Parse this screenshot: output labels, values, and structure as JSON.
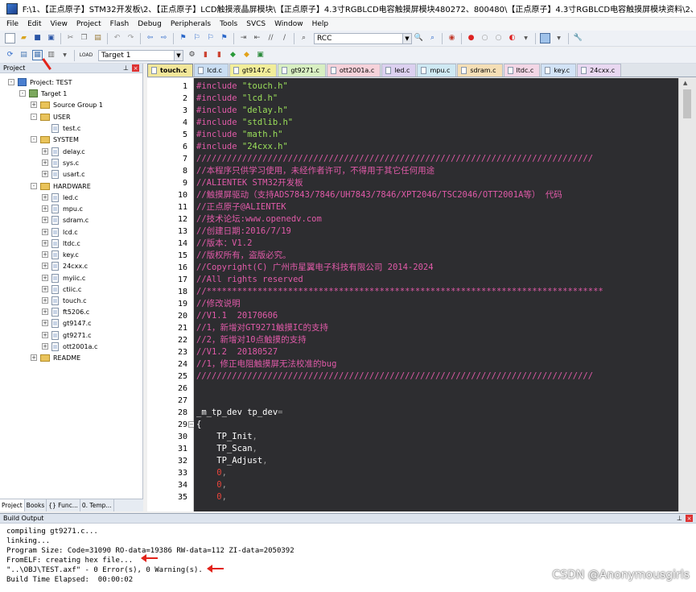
{
  "window": {
    "title": "F:\\1、【正点原子】STM32开发板\\2、【正点原子】LCD触摸液晶屏模块\\【正点原子】4.3寸RGBLCD电容触摸屏模块480272、800480\\【正点原子】4.3寸RGBLCD电容触摸屏模块资料\\2、程..."
  },
  "menu": [
    "File",
    "Edit",
    "View",
    "Project",
    "Flash",
    "Debug",
    "Peripherals",
    "Tools",
    "SVCS",
    "Window",
    "Help"
  ],
  "toolbar": {
    "combo_rcc": "RCC",
    "target_select": "Target 1",
    "load_label": "LOAD"
  },
  "project": {
    "header": "Project",
    "tree": [
      {
        "label": "Project: TEST",
        "depth": 0,
        "type": "project",
        "exp": "-"
      },
      {
        "label": "Target 1",
        "depth": 1,
        "type": "target",
        "exp": "-"
      },
      {
        "label": "Source Group 1",
        "depth": 2,
        "type": "folder",
        "exp": "+"
      },
      {
        "label": "USER",
        "depth": 2,
        "type": "folder",
        "exp": "-"
      },
      {
        "label": "test.c",
        "depth": 3,
        "type": "file",
        "exp": ""
      },
      {
        "label": "SYSTEM",
        "depth": 2,
        "type": "folder",
        "exp": "-"
      },
      {
        "label": "delay.c",
        "depth": 3,
        "type": "file",
        "exp": "+"
      },
      {
        "label": "sys.c",
        "depth": 3,
        "type": "file",
        "exp": "+"
      },
      {
        "label": "usart.c",
        "depth": 3,
        "type": "file",
        "exp": "+"
      },
      {
        "label": "HARDWARE",
        "depth": 2,
        "type": "folder",
        "exp": "-"
      },
      {
        "label": "led.c",
        "depth": 3,
        "type": "file",
        "exp": "+"
      },
      {
        "label": "mpu.c",
        "depth": 3,
        "type": "file",
        "exp": "+"
      },
      {
        "label": "sdram.c",
        "depth": 3,
        "type": "file",
        "exp": "+"
      },
      {
        "label": "lcd.c",
        "depth": 3,
        "type": "file",
        "exp": "+"
      },
      {
        "label": "ltdc.c",
        "depth": 3,
        "type": "file",
        "exp": "+"
      },
      {
        "label": "key.c",
        "depth": 3,
        "type": "file",
        "exp": "+"
      },
      {
        "label": "24cxx.c",
        "depth": 3,
        "type": "file",
        "exp": "+"
      },
      {
        "label": "myiic.c",
        "depth": 3,
        "type": "file",
        "exp": "+"
      },
      {
        "label": "ctiic.c",
        "depth": 3,
        "type": "file",
        "exp": "+"
      },
      {
        "label": "touch.c",
        "depth": 3,
        "type": "file",
        "exp": "+"
      },
      {
        "label": "ft5206.c",
        "depth": 3,
        "type": "file",
        "exp": "+"
      },
      {
        "label": "gt9147.c",
        "depth": 3,
        "type": "file",
        "exp": "+"
      },
      {
        "label": "gt9271.c",
        "depth": 3,
        "type": "file",
        "exp": "+"
      },
      {
        "label": "ott2001a.c",
        "depth": 3,
        "type": "file",
        "exp": "+"
      },
      {
        "label": "README",
        "depth": 2,
        "type": "folder",
        "exp": "+"
      }
    ],
    "tabs": [
      "Project",
      "Books",
      "{} Func...",
      "0. Temp..."
    ]
  },
  "editor": {
    "tabs": [
      {
        "label": "touch.c",
        "color": "#f2e79a",
        "active": true
      },
      {
        "label": "lcd.c",
        "color": "#c9ddf2",
        "active": false
      },
      {
        "label": "gt9147.c",
        "color": "#f2ee9a",
        "active": false
      },
      {
        "label": "gt9271.c",
        "color": "#d8efc2",
        "active": false
      },
      {
        "label": "ott2001a.c",
        "color": "#f6d2da",
        "active": false
      },
      {
        "label": "led.c",
        "color": "#dcd0f0",
        "active": false
      },
      {
        "label": "mpu.c",
        "color": "#cfe9f3",
        "active": false
      },
      {
        "label": "sdram.c",
        "color": "#f5dfb6",
        "active": false
      },
      {
        "label": "ltdc.c",
        "color": "#f3d7e6",
        "active": false
      },
      {
        "label": "key.c",
        "color": "#d2e3f6",
        "active": false
      },
      {
        "label": "24cxx.c",
        "color": "#e9d8f1",
        "active": false
      }
    ],
    "lines": [
      {
        "n": "1",
        "segs": [
          {
            "t": "#include ",
            "c": "#e05aa8"
          },
          {
            "t": "\"touch.h\"",
            "c": "#9be05a"
          }
        ]
      },
      {
        "n": "2",
        "segs": [
          {
            "t": "#include ",
            "c": "#e05aa8"
          },
          {
            "t": "\"lcd.h\"",
            "c": "#9be05a"
          }
        ]
      },
      {
        "n": "3",
        "segs": [
          {
            "t": "#include ",
            "c": "#e05aa8"
          },
          {
            "t": "\"delay.h\"",
            "c": "#9be05a"
          }
        ]
      },
      {
        "n": "4",
        "segs": [
          {
            "t": "#include ",
            "c": "#e05aa8"
          },
          {
            "t": "\"stdlib.h\"",
            "c": "#9be05a"
          }
        ]
      },
      {
        "n": "5",
        "segs": [
          {
            "t": "#include ",
            "c": "#e05aa8"
          },
          {
            "t": "\"math.h\"",
            "c": "#9be05a"
          }
        ]
      },
      {
        "n": "6",
        "segs": [
          {
            "t": "#include ",
            "c": "#e05aa8"
          },
          {
            "t": "\"24cxx.h\"",
            "c": "#9be05a"
          }
        ]
      },
      {
        "n": "7",
        "segs": [
          {
            "t": "//////////////////////////////////////////////////////////////////////////////",
            "c": "#e05aa8"
          }
        ]
      },
      {
        "n": "8",
        "segs": [
          {
            "t": "//本程序只供学习使用，未经作者许可，不得用于其它任何用途",
            "c": "#e05aa8"
          }
        ]
      },
      {
        "n": "9",
        "segs": [
          {
            "t": "//ALIENTEK STM32开发板",
            "c": "#e05aa8"
          }
        ]
      },
      {
        "n": "10",
        "segs": [
          {
            "t": "//触摸屏驱动（支持ADS7843/7846/UH7843/7846/XPT2046/TSC2046/OTT2001A等） 代码",
            "c": "#e05aa8"
          }
        ]
      },
      {
        "n": "11",
        "segs": [
          {
            "t": "//正点原子@ALIENTEK",
            "c": "#e05aa8"
          }
        ]
      },
      {
        "n": "12",
        "segs": [
          {
            "t": "//技术论坛:www.openedv.com",
            "c": "#e05aa8"
          }
        ]
      },
      {
        "n": "13",
        "segs": [
          {
            "t": "//创建日期:2016/7/19",
            "c": "#e05aa8"
          }
        ]
      },
      {
        "n": "14",
        "segs": [
          {
            "t": "//版本：V1.2",
            "c": "#e05aa8"
          }
        ]
      },
      {
        "n": "15",
        "segs": [
          {
            "t": "//版权所有，盗版必究。",
            "c": "#e05aa8"
          }
        ]
      },
      {
        "n": "16",
        "segs": [
          {
            "t": "//Copyright(C) 广州市星翼电子科技有限公司 2014-2024",
            "c": "#e05aa8"
          }
        ]
      },
      {
        "n": "17",
        "segs": [
          {
            "t": "//All rights reserved",
            "c": "#e05aa8"
          }
        ]
      },
      {
        "n": "18",
        "segs": [
          {
            "t": "//******************************************************************************",
            "c": "#e05aa8"
          }
        ]
      },
      {
        "n": "19",
        "segs": [
          {
            "t": "//修改说明",
            "c": "#e05aa8"
          }
        ]
      },
      {
        "n": "20",
        "segs": [
          {
            "t": "//V1.1  20170606",
            "c": "#e05aa8"
          }
        ]
      },
      {
        "n": "21",
        "segs": [
          {
            "t": "//1，新增对GT9271触摸IC的支持",
            "c": "#e05aa8"
          }
        ]
      },
      {
        "n": "22",
        "segs": [
          {
            "t": "//2，新增对10点触摸的支持",
            "c": "#e05aa8"
          }
        ]
      },
      {
        "n": "23",
        "segs": [
          {
            "t": "//V1.2  20180527",
            "c": "#e05aa8"
          }
        ]
      },
      {
        "n": "24",
        "segs": [
          {
            "t": "//1，修正电阻触摸屏无法校准的bug",
            "c": "#e05aa8"
          }
        ]
      },
      {
        "n": "25",
        "segs": [
          {
            "t": "//////////////////////////////////////////////////////////////////////////////",
            "c": "#e05aa8"
          }
        ]
      },
      {
        "n": "26",
        "segs": []
      },
      {
        "n": "27",
        "segs": []
      },
      {
        "n": "28",
        "segs": [
          {
            "t": "_m_tp_dev tp_dev",
            "c": "#ffffff"
          },
          {
            "t": "=",
            "c": "#9a9a9a"
          }
        ]
      },
      {
        "n": "29",
        "segs": [
          {
            "t": "{",
            "c": "#ffffff"
          }
        ]
      },
      {
        "n": "30",
        "segs": [
          {
            "t": "    TP_Init",
            "c": "#ffffff"
          },
          {
            "t": ",",
            "c": "#9a9a9a"
          }
        ]
      },
      {
        "n": "31",
        "segs": [
          {
            "t": "    TP_Scan",
            "c": "#ffffff"
          },
          {
            "t": ",",
            "c": "#9a9a9a"
          }
        ]
      },
      {
        "n": "32",
        "segs": [
          {
            "t": "    TP_Adjust",
            "c": "#ffffff"
          },
          {
            "t": ",",
            "c": "#9a9a9a"
          }
        ]
      },
      {
        "n": "33",
        "segs": [
          {
            "t": "    0",
            "c": "#e8443b"
          },
          {
            "t": ",",
            "c": "#9a9a9a"
          }
        ]
      },
      {
        "n": "34",
        "segs": [
          {
            "t": "    0",
            "c": "#e8443b"
          },
          {
            "t": ",",
            "c": "#9a9a9a"
          }
        ]
      },
      {
        "n": "35",
        "segs": [
          {
            "t": "    0",
            "c": "#e8443b"
          },
          {
            "t": ",",
            "c": "#9a9a9a"
          }
        ]
      }
    ]
  },
  "build": {
    "header": "Build Output",
    "lines": [
      "compiling gt9271.c...",
      "linking...",
      "Program Size: Code=31090 RO-data=19386 RW-data=112 ZI-data=2050392",
      "FromELF: creating hex file...",
      "\"..\\OBJ\\TEST.axf\" - 0 Error(s), 0 Warning(s).",
      "Build Time Elapsed:  00:00:02"
    ]
  },
  "watermark": "CSDN @Anonymousgirls"
}
